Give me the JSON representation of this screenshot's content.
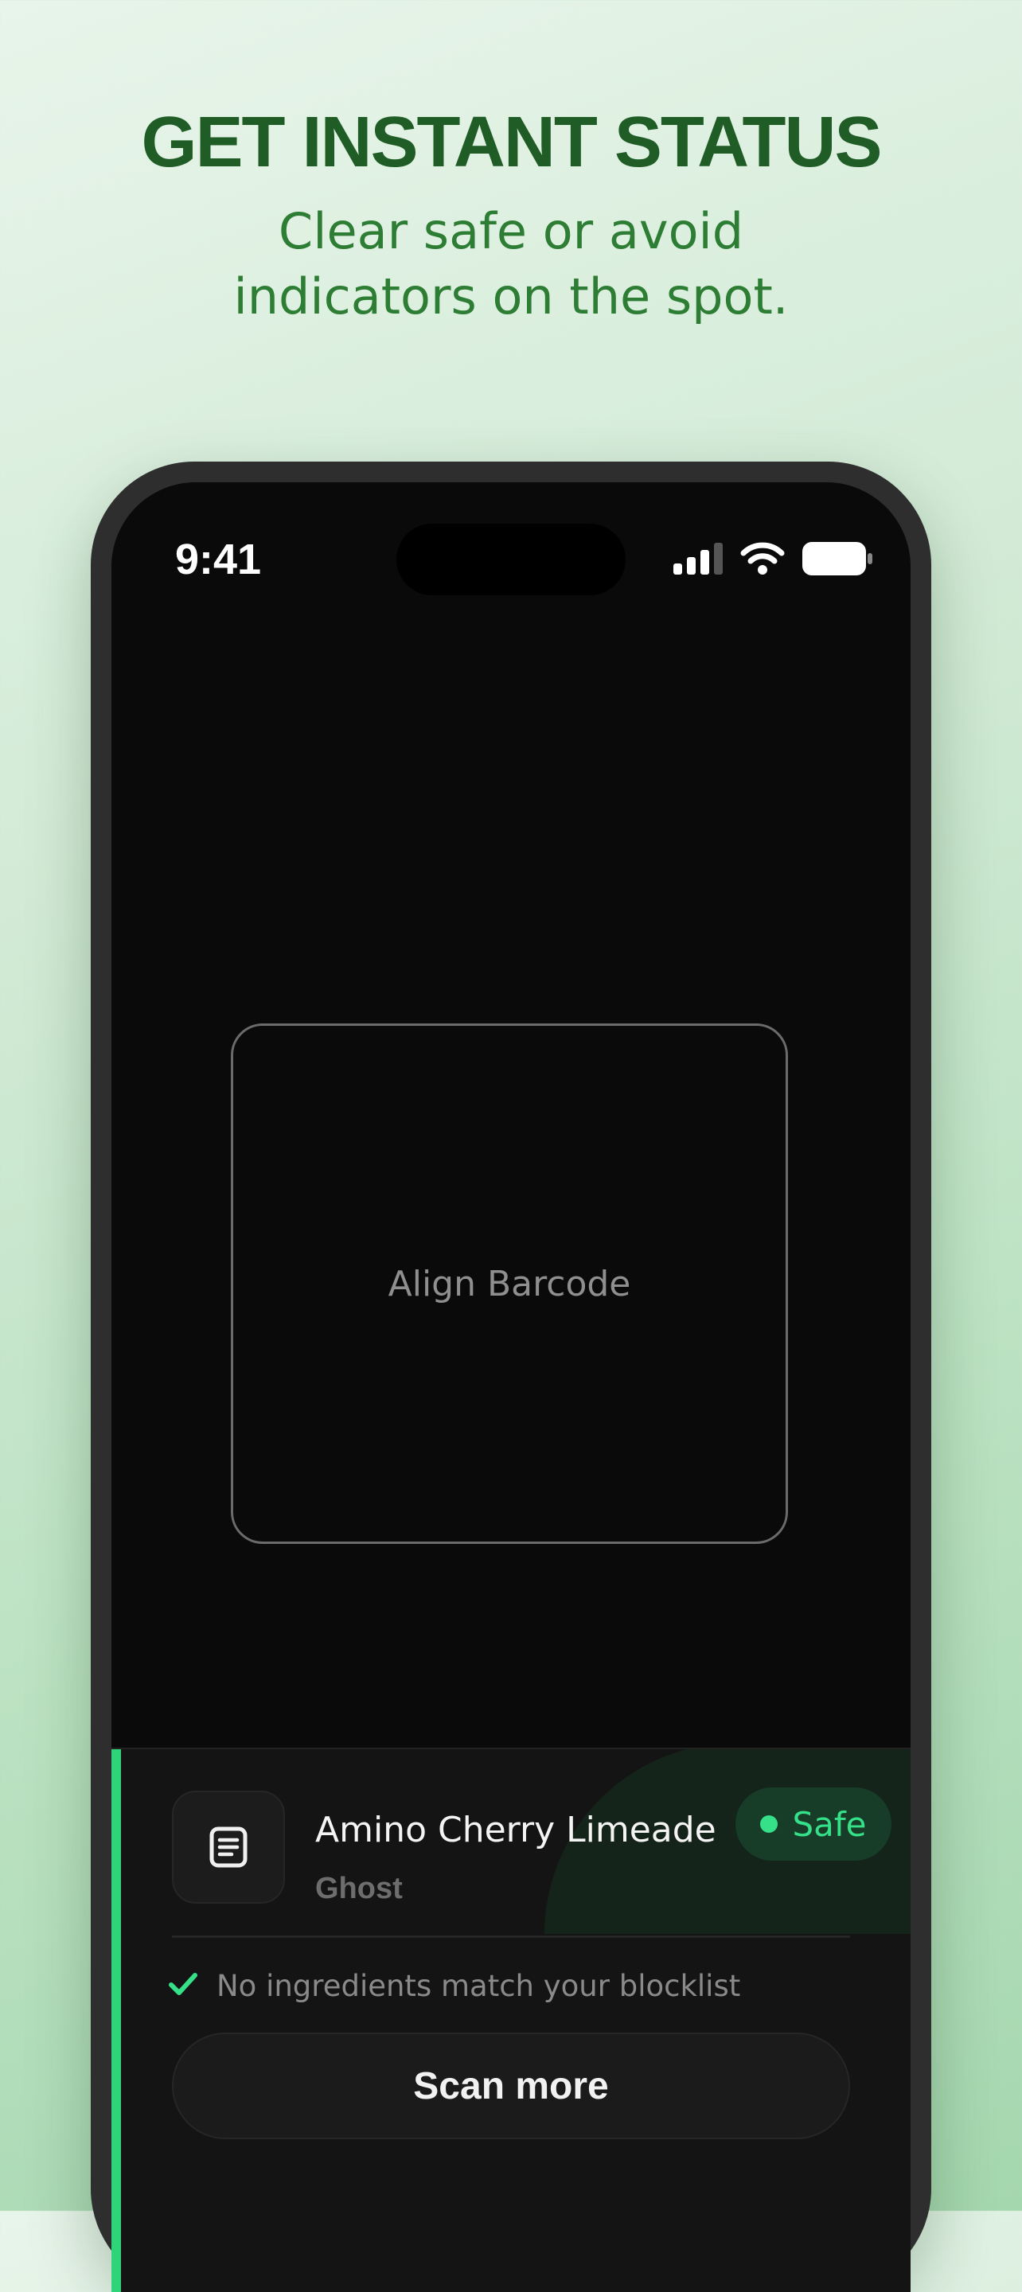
{
  "promo": {
    "headline": "GET INSTANT STATUS",
    "subheadline_line1": "Clear safe or avoid",
    "subheadline_line2": "indicators on the spot."
  },
  "status_bar": {
    "time": "9:41",
    "icons": [
      "cellular-signal-icon",
      "wifi-icon",
      "battery-icon"
    ]
  },
  "scanner": {
    "frame_label": "Align Barcode"
  },
  "result": {
    "product_name": "Amino Cherry Limeade",
    "brand": "Ghost",
    "status_label": "Safe",
    "match_message": "No ingredients match your blocklist",
    "scan_more_label": "Scan more",
    "product_icon": "document-icon",
    "check_icon": "checkmark-icon"
  },
  "colors": {
    "safe_accent": "#35e089",
    "headline": "#1f5c26",
    "subheadline": "#2e7d35"
  }
}
